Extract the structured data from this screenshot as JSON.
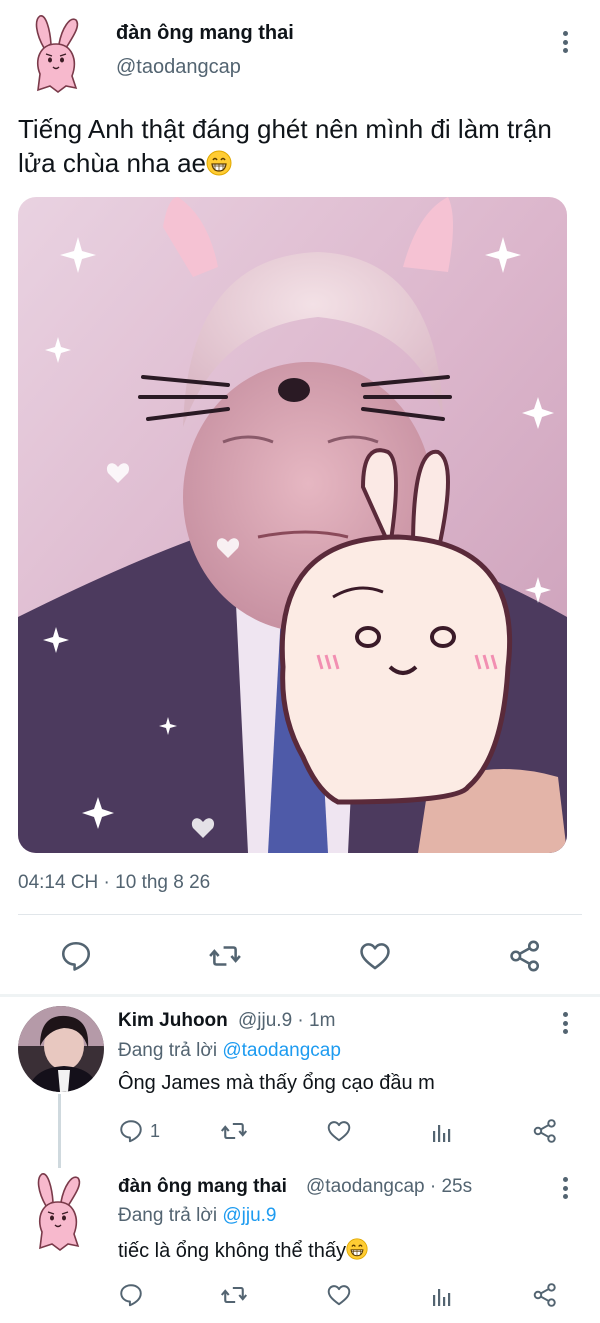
{
  "main_tweet": {
    "display_name": "đàn ông mang thai",
    "handle": "@taodangcap",
    "text": "Tiếng Anh thật đáng ghét nên mình đi làm trận lửa chùa nha ae",
    "timestamp": "04:14 CH · 10 thg 8 26"
  },
  "replies": [
    {
      "display_name": "Kim Juhoon",
      "handle_time": "@jju.9 · 1m",
      "replying_prefix": "Đang trả lời ",
      "replying_to": "@taodangcap",
      "text": "Ông James mà thấy ổng cạo đầu m",
      "reply_count": "1"
    },
    {
      "display_name": "đàn ông mang thai",
      "handle_time": "@taodangcap · 25s",
      "replying_prefix": "Đang trả lời ",
      "replying_to": "@jju.9",
      "text": "tiếc là ổng không thể thấy"
    }
  ],
  "icons": {
    "reply": "speech-bubble",
    "retweet": "retweet-arrows",
    "like": "heart-outline",
    "share": "share-nodes",
    "analytics": "bar-chart",
    "more": "vertical-dots",
    "emoji": "grinning-face"
  },
  "colors": {
    "link": "#1d9bf0",
    "secondary_text": "#536471",
    "divider": "#e1e6ea"
  }
}
